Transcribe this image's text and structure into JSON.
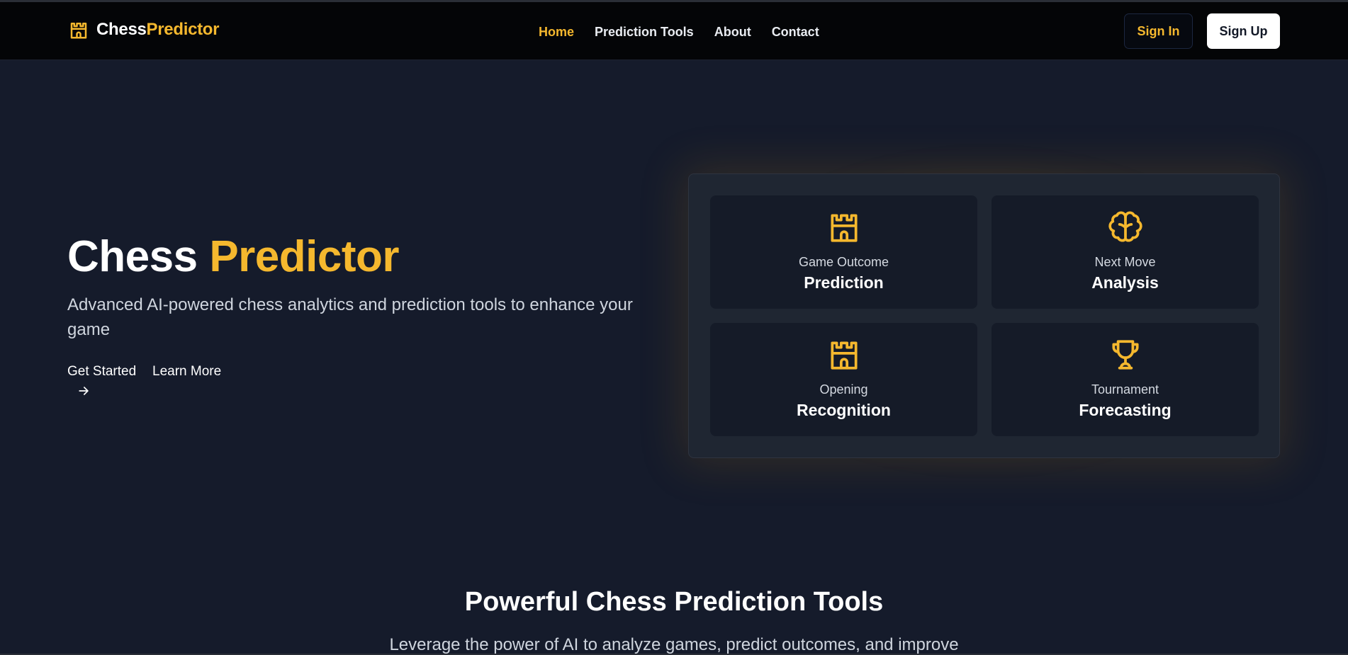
{
  "brand": {
    "part1": "Chess",
    "part2": "Predictor",
    "icon": "castle-icon"
  },
  "nav": {
    "home": "Home",
    "tools": "Prediction Tools",
    "about": "About",
    "contact": "Contact"
  },
  "auth": {
    "signin": "Sign In",
    "signup": "Sign Up"
  },
  "hero": {
    "title_part1": "Chess",
    "title_part2": "Predictor",
    "subtitle": "Advanced AI-powered chess analytics and prediction tools to enhance your game",
    "get_started": "Get Started",
    "learn_more": "Learn More"
  },
  "features": [
    {
      "icon": "castle-icon",
      "top": "Game Outcome",
      "main": "Prediction"
    },
    {
      "icon": "brain-icon",
      "top": "Next Move",
      "main": "Analysis"
    },
    {
      "icon": "castle-icon",
      "top": "Opening",
      "main": "Recognition"
    },
    {
      "icon": "trophy-icon",
      "top": "Tournament",
      "main": "Forecasting"
    }
  ],
  "section": {
    "title": "Powerful Chess Prediction Tools",
    "subtitle": "Leverage the power of AI to analyze games, predict outcomes, and improve"
  },
  "colors": {
    "accent": "#f5b82e",
    "background": "#151b2b",
    "navbar": "#040507",
    "card": "#151b28",
    "panel": "#1f2632"
  }
}
